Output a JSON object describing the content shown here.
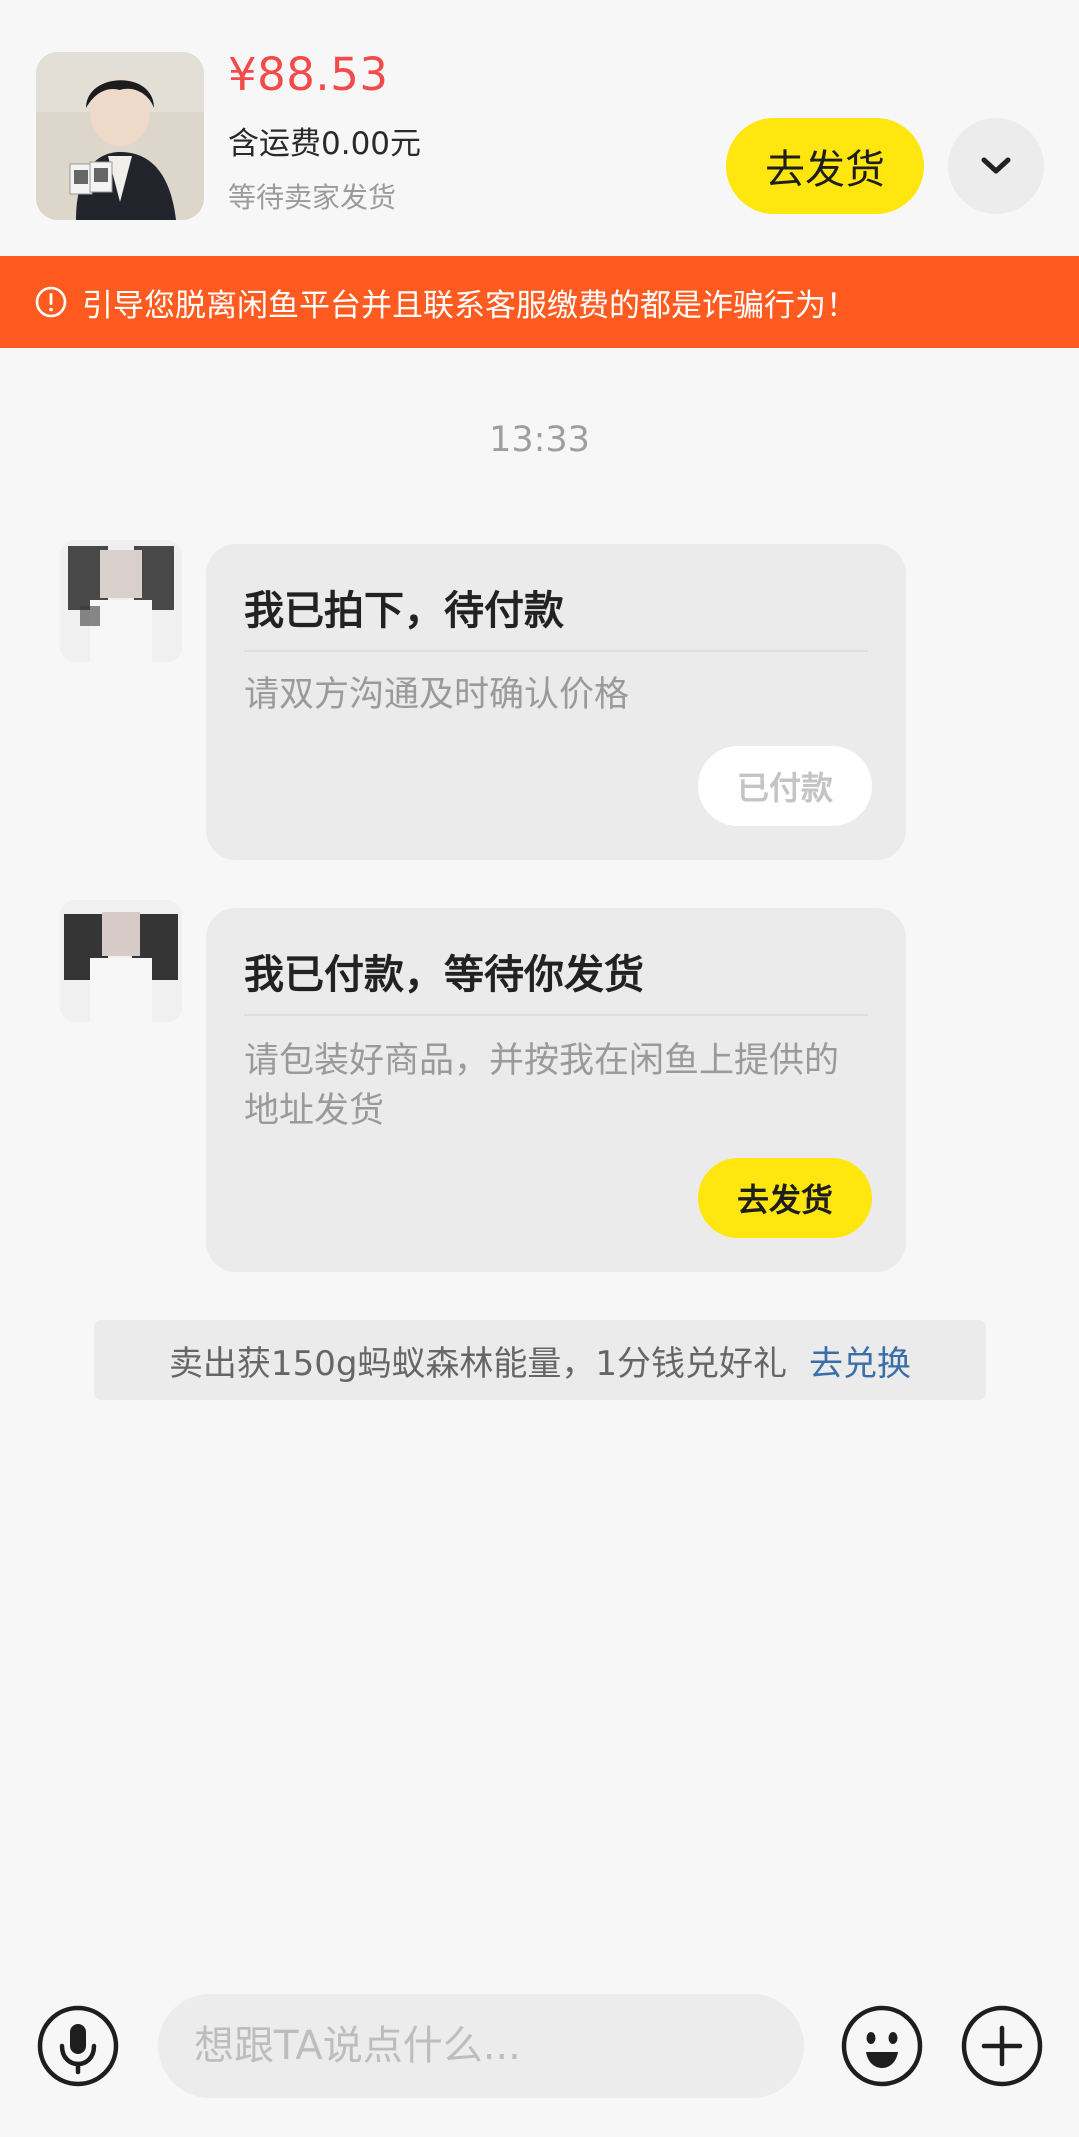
{
  "header": {
    "price": "¥88.53",
    "shipping": "含运费0.00元",
    "status": "等待卖家发货",
    "ship_button": "去发货",
    "dropdown_icon": "chevron-down-icon"
  },
  "warning": {
    "icon": "alert-circle-icon",
    "text": "引导您脱离闲鱼平台并且联系客服缴费的都是诈骗行为！"
  },
  "chat": {
    "time": "13:33",
    "messages": [
      {
        "title": "我已拍下，待付款",
        "desc": "请双方沟通及时确认价格",
        "button": "已付款"
      },
      {
        "title": "我已付款，等待你发货",
        "desc": "请包装好商品，并按我在闲鱼上提供的地址发货",
        "button": "去发货"
      }
    ],
    "promo": {
      "text": "卖出获150g蚂蚁森林能量，1分钱兑好礼",
      "link": "去兑换"
    }
  },
  "input_bar": {
    "placeholder": "想跟TA说点什么...",
    "voice_icon": "microphone-icon",
    "emoji_icon": "emoji-icon",
    "more_icon": "plus-icon"
  },
  "colors": {
    "accent_yellow": "#ffe60f",
    "price_red": "#f24b4b",
    "warning_orange": "#ff5a1f",
    "link_blue": "#3a6ea8"
  }
}
